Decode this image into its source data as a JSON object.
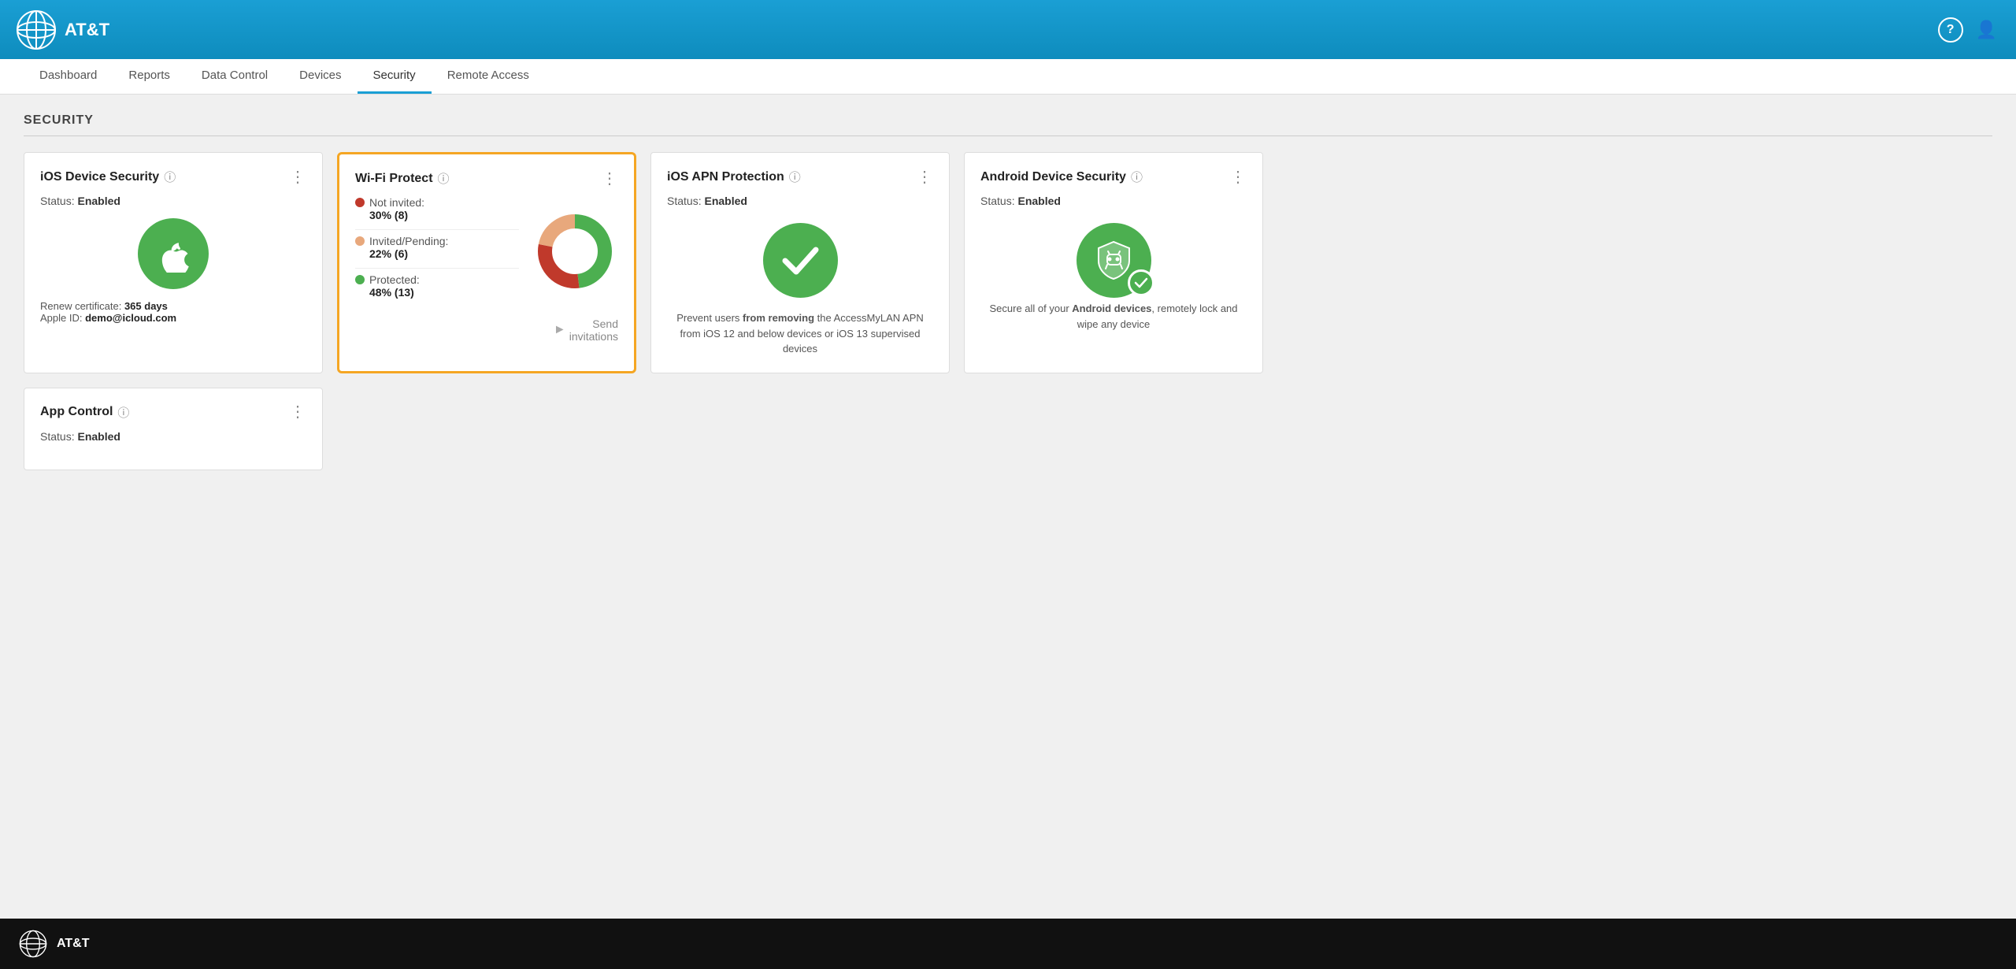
{
  "header": {
    "brand": "AT&T",
    "help_icon": "?",
    "user_icon": "👤"
  },
  "nav": {
    "items": [
      {
        "label": "Dashboard",
        "active": false
      },
      {
        "label": "Reports",
        "active": false
      },
      {
        "label": "Data Control",
        "active": false
      },
      {
        "label": "Devices",
        "active": false
      },
      {
        "label": "Security",
        "active": true
      },
      {
        "label": "Remote Access",
        "active": false
      }
    ]
  },
  "page": {
    "title": "SECURITY"
  },
  "cards": [
    {
      "id": "ios-device-security",
      "title": "iOS Device Security",
      "highlighted": false,
      "status_label": "Status:",
      "status_value": "Enabled",
      "footer_line1": "Renew certificate:",
      "footer_bold1": "365 days",
      "footer_line2": "Apple ID:",
      "footer_bold2": "demo@icloud.com"
    },
    {
      "id": "wifi-protect",
      "title": "Wi-Fi Protect",
      "highlighted": true,
      "legend": [
        {
          "color": "#c0392b",
          "label": "Not invited:",
          "value": "30% (8)"
        },
        {
          "color": "#e8a87c",
          "label": "Invited/Pending:",
          "value": "22% (6)"
        },
        {
          "color": "#4caf50",
          "label": "Protected:",
          "value": "48% (13)"
        }
      ],
      "donut": {
        "not_invited_pct": 30,
        "invited_pct": 22,
        "protected_pct": 48,
        "colors": [
          "#c0392b",
          "#e8a87c",
          "#4caf50"
        ]
      },
      "send_label": "Send\ninvitations"
    },
    {
      "id": "ios-apn-protection",
      "title": "iOS APN Protection",
      "highlighted": false,
      "status_label": "Status:",
      "status_value": "Enabled",
      "desc_normal": "Prevent users ",
      "desc_bold": "from removing",
      "desc_normal2": " the AccessMyLAN APN from iOS 12 and below devices or iOS 13 supervised devices"
    },
    {
      "id": "android-device-security",
      "title": "Android Device Security",
      "highlighted": false,
      "status_label": "Status:",
      "status_value": "Enabled",
      "desc_normal": "Secure all of your ",
      "desc_bold": "Android devices",
      "desc_normal2": ", remotely lock and wipe any device"
    }
  ],
  "row2_cards": [
    {
      "id": "app-control",
      "title": "App Control",
      "highlighted": false,
      "status_label": "Status:",
      "status_value": "Enabled"
    }
  ],
  "footer": {
    "brand": "AT&T"
  }
}
